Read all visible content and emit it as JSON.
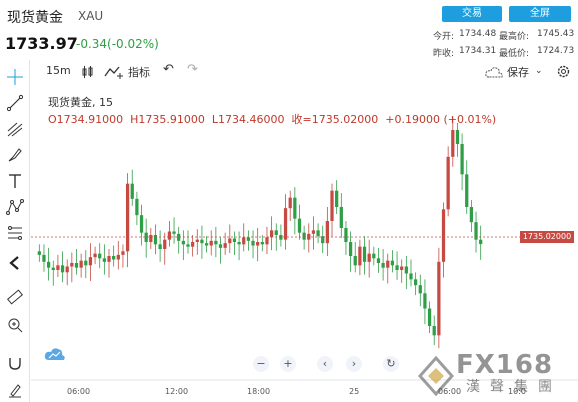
{
  "header": {
    "name": "现货黄金",
    "code": "XAU",
    "price": "1733.97",
    "change": "-0.34(-0.02%)",
    "btn_trade": "交易",
    "btn_full": "全屏",
    "stats": [
      {
        "label": "今开:",
        "value": "1734.48"
      },
      {
        "label": "最高价:",
        "value": "1745.43"
      },
      {
        "label": "昨收:",
        "value": "1734.31"
      },
      {
        "label": "最低价:",
        "value": "1724.73"
      }
    ]
  },
  "toolbar": {
    "interval": "15m",
    "indicators": "指标",
    "save": "保存"
  },
  "legend": {
    "title": "现货黄金, 15",
    "open": "O1734.91000",
    "high": "H1735.91000",
    "low": "L1734.46000",
    "close_label": "收=1735.02000",
    "change": "+0.19000 (+0.01%)"
  },
  "price_tag": "1735.02000",
  "xaxis": [
    "06:00",
    "12:00",
    "18:00",
    "25",
    "06:00",
    "10:0"
  ],
  "watermark": {
    "brand": "FX168",
    "sub": "漢聲集團"
  },
  "colors": {
    "up": "#c74a42",
    "down": "#2e9e47",
    "accent": "#1e9ede"
  },
  "chart_data": {
    "type": "candlestick",
    "last_price": 1735.02,
    "candles_close_approx": [
      1734.1,
      1733.5,
      1733.0,
      1732.8,
      1733.2,
      1732.6,
      1733.1,
      1733.4,
      1733.0,
      1733.6,
      1733.2,
      1733.9,
      1734.2,
      1733.8,
      1733.5,
      1734.0,
      1733.7,
      1734.1,
      1734.4,
      1740.2,
      1738.9,
      1737.5,
      1736.0,
      1735.2,
      1735.8,
      1735.0,
      1734.6,
      1735.4,
      1736.1,
      1735.9,
      1735.3,
      1735.0,
      1734.8,
      1735.2,
      1735.4,
      1735.1,
      1734.9,
      1735.3,
      1735.0,
      1734.7,
      1735.1,
      1735.5,
      1735.2,
      1735.0,
      1735.6,
      1735.3,
      1734.9,
      1735.2,
      1735.0,
      1735.6,
      1736.2,
      1735.8,
      1735.4,
      1738.1,
      1739.0,
      1737.2,
      1736.0,
      1735.4,
      1735.9,
      1736.2,
      1735.7,
      1735.1,
      1737.0,
      1739.6,
      1738.2,
      1736.4,
      1735.2,
      1734.0,
      1733.2,
      1734.8,
      1733.5,
      1734.2,
      1733.8,
      1733.4,
      1733.0,
      1733.6,
      1733.2,
      1732.8,
      1733.1,
      1732.5,
      1732.0,
      1731.5,
      1730.8,
      1729.5,
      1728.0,
      1727.2,
      1733.5,
      1738.0,
      1742.5,
      1744.8,
      1743.6,
      1741.0,
      1738.2,
      1736.9,
      1735.4,
      1735.02
    ]
  }
}
